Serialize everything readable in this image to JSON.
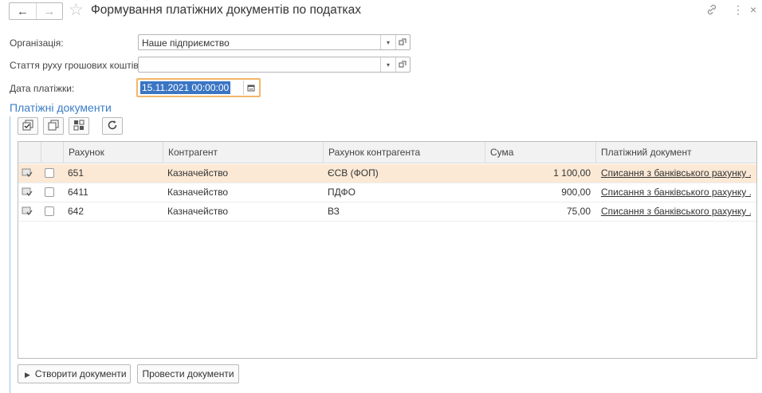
{
  "window": {
    "title": "Формування платіжних документів по податках",
    "back_glyph": "←",
    "forward_glyph": "→",
    "star_glyph": "☆",
    "link_glyph": "🔗",
    "more_glyph": "⋮",
    "close_glyph": "×"
  },
  "form": {
    "organization_label": "Організація:",
    "organization_value": "Наше підприємство",
    "cashflow_label": "Стаття руху грошових коштів:",
    "cashflow_value": "",
    "date_label": "Дата платіжки:",
    "date_value": "15.11.2021 00:00:00"
  },
  "section": {
    "title": "Платіжні документи"
  },
  "table": {
    "columns": [
      "Рахунок",
      "Контрагент",
      "Рахунок контрагента",
      "Сума",
      "Платіжний документ"
    ],
    "rows": [
      {
        "account": "651",
        "counterparty": "Казначейство",
        "counterparty_account": "ЄСВ (ФОП)",
        "amount": "1 100,00",
        "document": "Списання з банківського рахунку ...",
        "checked": false
      },
      {
        "account": "6411",
        "counterparty": "Казначейство",
        "counterparty_account": "ПДФО",
        "amount": "900,00",
        "document": "Списання з банківського рахунку ...",
        "checked": false
      },
      {
        "account": "642",
        "counterparty": "Казначейство",
        "counterparty_account": "ВЗ",
        "amount": "75,00",
        "document": "Списання з банківського рахунку ...",
        "checked": false
      }
    ],
    "selected_row": 0
  },
  "buttons": {
    "create": "Створити документи",
    "post": "Провести документи"
  },
  "colors": {
    "accent": "#3a7cc8",
    "selection": "#fbe9d6",
    "focus": "#f3b66b"
  }
}
